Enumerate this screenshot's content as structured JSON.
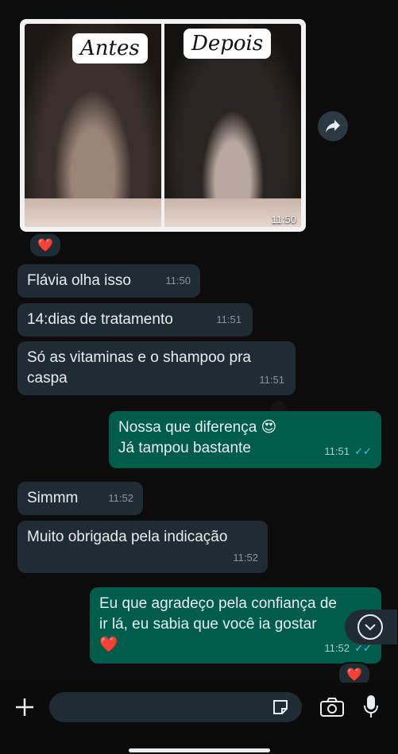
{
  "photo_message": {
    "label_before": "Antes",
    "label_after": "Depois",
    "time": "11:50",
    "reaction": "❤️"
  },
  "messages": [
    {
      "dir": "in",
      "text": "Flávia olha isso",
      "time": "11:50"
    },
    {
      "dir": "in",
      "text": "14:dias de tratamento",
      "time": "11:51"
    },
    {
      "dir": "in",
      "text_lines": [
        "Só as vitaminas e o shampoo pra",
        "caspa"
      ],
      "time": "11:51"
    },
    {
      "dir": "out",
      "text_lines": [
        "Nossa que diferença 😍",
        "Já tampou bastante"
      ],
      "time": "11:51"
    },
    {
      "dir": "in",
      "text": "Simmm",
      "time": "11:52"
    },
    {
      "dir": "in",
      "text": "Muito obrigada pela indicação",
      "time": "11:52"
    },
    {
      "dir": "out",
      "text_lines": [
        "Eu que agradeço pela confiança de",
        "ir lá, eu sabia que você ia gostar",
        "❤️"
      ],
      "time": "11:52",
      "reaction": "❤️"
    }
  ],
  "read_receipt": "✓✓",
  "input": {
    "placeholder": ""
  },
  "colors": {
    "incoming": "#202c33",
    "outgoing": "#005c4b",
    "background": "#0c0c0c",
    "read_ticks": "#53bdeb"
  }
}
